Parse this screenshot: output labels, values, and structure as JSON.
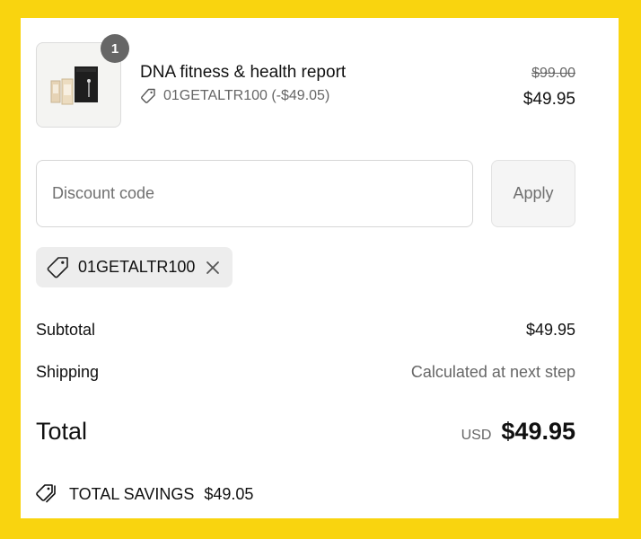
{
  "product": {
    "quantity": "1",
    "name": "DNA fitness & health report",
    "discount_line": "01GETALTR100 (-$49.05)",
    "price_original": "$99.00",
    "price_current": "$49.95",
    "image_icon": "dna-kit-product-image"
  },
  "discount": {
    "placeholder": "Discount code",
    "value": "",
    "apply_label": "Apply",
    "applied_code": "01GETALTR100",
    "tag_icon": "tag-icon",
    "remove_icon": "close-icon"
  },
  "summary": {
    "subtotal_label": "Subtotal",
    "subtotal_value": "$49.95",
    "shipping_label": "Shipping",
    "shipping_value": "Calculated at next step",
    "total_label": "Total",
    "total_currency": "USD",
    "total_value": "$49.95",
    "savings_label": "TOTAL SAVINGS",
    "savings_value": "$49.05",
    "savings_icon": "tags-icon"
  },
  "colors": {
    "frame": "#f9d40f",
    "badge": "#666666",
    "muted_text": "#666666",
    "tag_bg": "#ededed"
  }
}
